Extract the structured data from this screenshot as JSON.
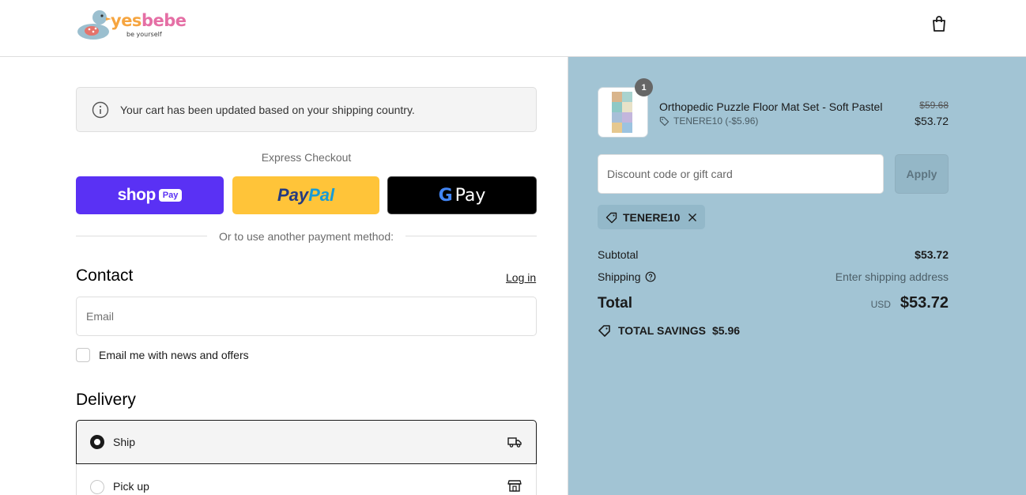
{
  "header": {
    "brand": {
      "part1": "yes",
      "part2": "bebe",
      "tagline": "be yourself"
    },
    "cart_icon": "shopping-bag-icon"
  },
  "notice": {
    "icon": "info-icon",
    "text": "Your cart has been updated based on your shipping country."
  },
  "express": {
    "title": "Express Checkout",
    "shop_pay": {
      "word": "shop",
      "chip": "Pay"
    },
    "paypal": {
      "part1": "Pay",
      "part2": "Pal"
    },
    "google_pay": {
      "g": "G",
      "pay": "Pay"
    },
    "divider": "Or to use another payment method:"
  },
  "contact": {
    "title": "Contact",
    "login_label": "Log in",
    "email_placeholder": "Email",
    "newsletter_label": "Email me with news and offers"
  },
  "delivery": {
    "title": "Delivery",
    "options": [
      {
        "label": "Ship",
        "selected": true,
        "icon": "truck-icon"
      },
      {
        "label": "Pick up",
        "selected": false,
        "icon": "store-icon"
      }
    ]
  },
  "summary": {
    "product": {
      "quantity": "1",
      "name": "Orthopedic Puzzle Floor Mat Set - Soft Pastel",
      "discount_label": "TENERE10 (-$5.96)",
      "price_original": "$59.68",
      "price_final": "$53.72"
    },
    "discount_placeholder": "Discount code or gift card",
    "apply_label": "Apply",
    "applied_code": "TENERE10",
    "subtotal_label": "Subtotal",
    "subtotal_value": "$53.72",
    "shipping_label": "Shipping",
    "shipping_value": "Enter shipping address",
    "total_label": "Total",
    "currency": "USD",
    "total_value": "$53.72",
    "savings_label": "TOTAL SAVINGS",
    "savings_value": "$5.96"
  },
  "colors": {
    "summary_bg": "#a2c4d4",
    "shop_pay": "#5a31f4",
    "paypal": "#ffc439",
    "gpay": "#000000"
  }
}
